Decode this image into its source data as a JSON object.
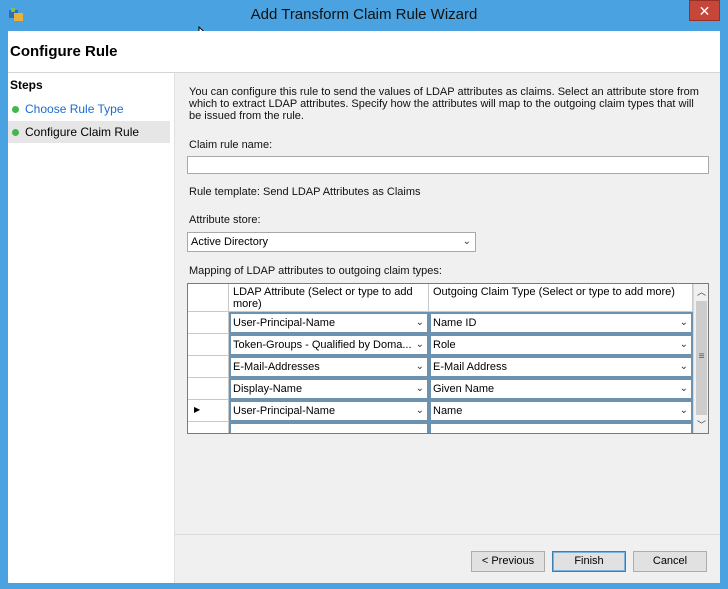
{
  "window": {
    "title": "Add Transform Claim Rule Wizard",
    "close_glyph": "✕"
  },
  "header": {
    "title": "Configure Rule"
  },
  "steps": {
    "heading": "Steps",
    "items": [
      {
        "label": "Choose Rule Type"
      },
      {
        "label": "Configure Claim Rule"
      }
    ]
  },
  "content": {
    "description": "You can configure this rule to send the values of LDAP attributes as claims. Select an attribute store from which to extract LDAP attributes. Specify how the attributes will map to the outgoing claim types that will be issued from the rule.",
    "claim_rule_name_label": "Claim rule name:",
    "claim_rule_name_value": "",
    "rule_template": "Rule template: Send LDAP Attributes as Claims",
    "attribute_store_label": "Attribute store:",
    "attribute_store_value": "Active Directory",
    "mapping_label": "Mapping of LDAP attributes to outgoing claim types:",
    "columns": {
      "ldap": "LDAP Attribute (Select or type to add more)",
      "claim": "Outgoing Claim Type (Select or type to add more)"
    },
    "rows": [
      {
        "ldap": "User-Principal-Name",
        "claim": "Name ID"
      },
      {
        "ldap": "Token-Groups - Qualified by Doma...",
        "claim": "Role"
      },
      {
        "ldap": "E-Mail-Addresses",
        "claim": "E-Mail Address"
      },
      {
        "ldap": "Display-Name",
        "claim": "Given Name"
      },
      {
        "ldap": "User-Principal-Name",
        "claim": "Name"
      }
    ]
  },
  "buttons": {
    "previous": "< Previous",
    "finish": "Finish",
    "cancel": "Cancel"
  },
  "colors": {
    "frame": "#4aa3e0",
    "close": "#c7463a",
    "step_dot": "#44b64d",
    "link": "#1a6bd0"
  }
}
